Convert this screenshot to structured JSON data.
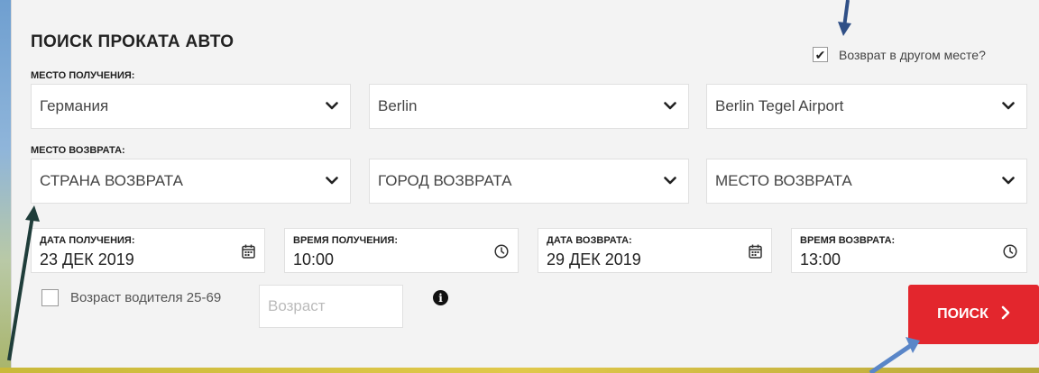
{
  "form": {
    "title": "ПОИСК ПРОКАТА АВТО",
    "pickup_section_label": "МЕСТО ПОЛУЧЕНИЯ:",
    "return_section_label": "МЕСТО ВОЗВРАТА:",
    "return_other_place": {
      "label": "Возврат в другом месте?",
      "checked": true,
      "check_glyph": "✔"
    },
    "pickup": {
      "country": "Германия",
      "city": "Berlin",
      "location": "Berlin Tegel Airport"
    },
    "return": {
      "country": "СТРАНА ВОЗВРАТА",
      "city": "ГОРОД ВОЗВРАТА",
      "location": "МЕСТО ВОЗВРАТА"
    },
    "pickup_date": {
      "label": "ДАТА ПОЛУЧЕНИЯ:",
      "value": "23 ДЕК 2019"
    },
    "pickup_time": {
      "label": "ВРЕМЯ ПОЛУЧЕНИЯ:",
      "value": "10:00"
    },
    "return_date": {
      "label": "ДАТА ВОЗВРАТА:",
      "value": "29 ДЕК 2019"
    },
    "return_time": {
      "label": "ВРЕМЯ ВОЗВРАТА:",
      "value": "13:00"
    },
    "driver_age": {
      "label": "Возраст водителя 25-69",
      "checked": false
    },
    "age_input": {
      "placeholder": "Возраст",
      "value": ""
    },
    "info_glyph": "i",
    "search_button": {
      "label": "ПОИСК",
      "chevron": "›"
    }
  },
  "colors": {
    "accent_red": "#e3262d",
    "annotation_arrow": "#2f4f86",
    "panel_bg": "#f3f3f3"
  },
  "icons": {
    "dropdown": "chevron-down-icon",
    "date": "calendar-icon",
    "time": "clock-icon",
    "info": "info-icon"
  }
}
